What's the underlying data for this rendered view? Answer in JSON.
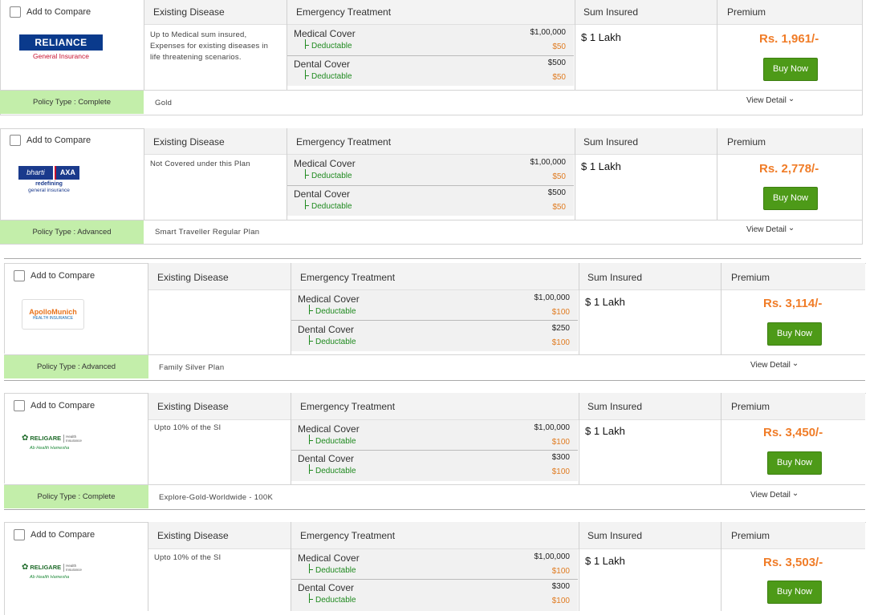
{
  "headers": {
    "existing_disease": "Existing Disease",
    "emergency_treatment": "Emergency Treatment",
    "sum_insured": "Sum Insured",
    "premium": "Premium"
  },
  "compare_label": "Add to Compare",
  "buy_label": "Buy Now",
  "view_detail": "View Detail",
  "deductable_label": "Deductable",
  "policies": [
    {
      "insurer": "Reliance General Insurance",
      "logo": {
        "line1": "RELIANCE",
        "line2": "General Insurance",
        "color": "#0a3a8c"
      },
      "existing_disease": "Up to Medical sum insured, Expenses for existing diseases in life threatening scenarios.",
      "medical": {
        "name": "Medical Cover",
        "amount": "$1,00,000",
        "deductible": "$50"
      },
      "dental": {
        "name": "Dental Cover",
        "amount": "$500",
        "deductible": "$50"
      },
      "sum_insured": "$ 1 Lakh",
      "premium": "Rs. 1,961/-",
      "policy_type": "Policy Type : Complete",
      "plan": "Gold"
    },
    {
      "insurer": "Bharti AXA",
      "logo": {
        "line1": "bharti",
        "line2": "AXA",
        "line3": "redefining",
        "line4": "general insurance",
        "color": "#1a3a8c"
      },
      "existing_disease": "Not Covered under this Plan",
      "medical": {
        "name": "Medical Cover",
        "amount": "$1,00,000",
        "deductible": "$50"
      },
      "dental": {
        "name": "Dental Cover",
        "amount": "$500",
        "deductible": "$50"
      },
      "sum_insured": "$ 1 Lakh",
      "premium": "Rs. 2,778/-",
      "policy_type": "Policy Type : Advanced",
      "plan": "Smart Traveller Regular Plan"
    },
    {
      "insurer": "Apollo Munich",
      "logo": {
        "line1": "ApolloMunich",
        "line2": "HEALTH INSURANCE",
        "color": "#e8731c"
      },
      "existing_disease": "",
      "medical": {
        "name": "Medical Cover",
        "amount": "$1,00,000",
        "deductible": "$100"
      },
      "dental": {
        "name": "Dental Cover",
        "amount": "$250",
        "deductible": "$100"
      },
      "sum_insured": "$ 1 Lakh",
      "premium": "Rs. 3,114/-",
      "policy_type": "Policy Type : Advanced",
      "plan": "Family Silver Plan"
    },
    {
      "insurer": "Religare Health Insurance",
      "logo": {
        "line1": "RELIGARE",
        "line2": "Health Insurance",
        "line3": "Ab Health Hamesha",
        "color": "#1f6b2a"
      },
      "existing_disease": "Upto 10% of the SI",
      "medical": {
        "name": "Medical Cover",
        "amount": "$1,00,000",
        "deductible": "$100"
      },
      "dental": {
        "name": "Dental Cover",
        "amount": "$300",
        "deductible": "$100"
      },
      "sum_insured": "$ 1 Lakh",
      "premium": "Rs. 3,450/-",
      "policy_type": "Policy Type : Complete",
      "plan": "Explore-Gold-Worldwide - 100K"
    },
    {
      "insurer": "Religare Health Insurance",
      "logo": {
        "line1": "RELIGARE",
        "line2": "Health Insurance",
        "line3": "Ab Health Hamesha",
        "color": "#1f6b2a"
      },
      "existing_disease": "Upto 10% of the SI",
      "medical": {
        "name": "Medical Cover",
        "amount": "$1,00,000",
        "deductible": "$100"
      },
      "dental": {
        "name": "Dental Cover",
        "amount": "$300",
        "deductible": "$100"
      },
      "sum_insured": "$ 1 Lakh",
      "premium": "Rs. 3,503/-",
      "policy_type": "",
      "plan": ""
    }
  ]
}
